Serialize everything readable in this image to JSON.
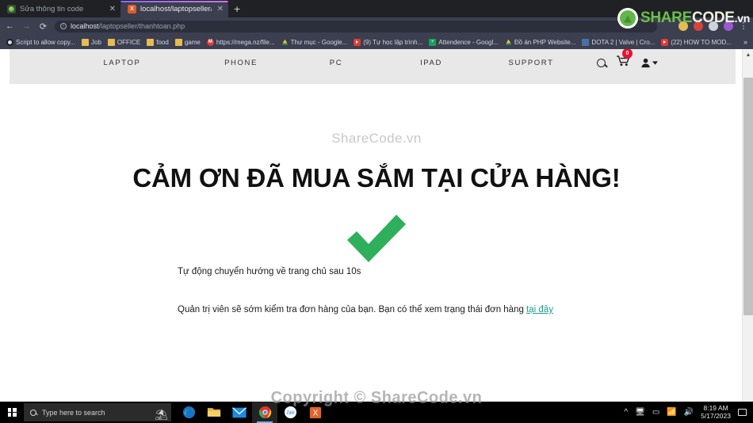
{
  "browser": {
    "tabs": [
      {
        "title": "Sửa thông tin code",
        "favicon": "sharecode-favicon",
        "active": false
      },
      {
        "title": "localhost/laptopseller/thanhtoan",
        "favicon": "xampp-favicon",
        "active": true
      }
    ],
    "new_tab_label": "+",
    "close_label": "✕",
    "nav": {
      "back": "←",
      "forward": "→",
      "reload": "⟳"
    },
    "omnibox": {
      "host": "localhost",
      "path": "/laptopseller/thanhtoan.php",
      "info_icon": "ⓘ"
    },
    "bookmarks": [
      {
        "label": "Script to allow copy...",
        "icon": "github-icon"
      },
      {
        "label": "Job",
        "icon": "folder-icon"
      },
      {
        "label": "OFFICE",
        "icon": "folder-icon"
      },
      {
        "label": "food",
        "icon": "folder-icon"
      },
      {
        "label": "game",
        "icon": "folder-icon"
      },
      {
        "label": "https://mega.nz/file...",
        "icon": "mega-icon"
      },
      {
        "label": "Thư mục - Google...",
        "icon": "drive-icon"
      },
      {
        "label": "(9) Tự học lập trình...",
        "icon": "youtube-icon"
      },
      {
        "label": "Attendence - Googl...",
        "icon": "sheets-icon"
      },
      {
        "label": "Đồ án PHP Website...",
        "icon": "drive-icon"
      },
      {
        "label": "DOTA 2 | Valve | Cro...",
        "icon": "steam-icon"
      },
      {
        "label": "(22) HOW TO MOD...",
        "icon": "youtube-icon"
      }
    ],
    "bookmarks_overflow": "»"
  },
  "site": {
    "nav_items": [
      "LAPTOP",
      "PHONE",
      "PC",
      "IPAD",
      "SUPPORT"
    ],
    "icons": {
      "search": "search-icon",
      "cart": "cart-icon",
      "user": "user-icon"
    },
    "cart_count": "0"
  },
  "page": {
    "watermark_top": "ShareCode.vn",
    "title": "CẢM ƠN ĐÃ MUA SẮM TẠI CỬA HÀNG!",
    "success_icon": "check-icon",
    "redirect_text": "Tự động chuyển hướng về trang chủ sau 10s",
    "status_text_before": "Quản trị viên sẽ sớm kiểm tra đơn hàng của bạn. Bạn có thể xem trạng thái đơn hàng ",
    "status_link": "tại đây",
    "copyright_watermark": "Copyright © ShareCode.vn",
    "logo": {
      "share": "SHARE",
      "code": "CODE",
      "vn": ".vn"
    },
    "colors": {
      "check_green": "#2eaf5c",
      "link_teal": "#1e9e8a",
      "badge_red": "#e8112d",
      "nav_bg": "#e8e8e8"
    }
  },
  "scrollbar": {
    "up_arrow": "▲"
  },
  "taskbar": {
    "search_placeholder": "Type here to search",
    "apps": [
      "edge-icon",
      "file-explorer-icon",
      "mail-icon",
      "chrome-icon",
      "zalo-icon",
      "xampp-icon"
    ],
    "tray": {
      "overflow": "︿",
      "icons": [
        "remote-icon",
        "battery-icon",
        "wifi-icon",
        "volume-icon"
      ]
    },
    "time": "8:19 AM",
    "date": "5/17/2023",
    "notification": "notification-icon"
  }
}
